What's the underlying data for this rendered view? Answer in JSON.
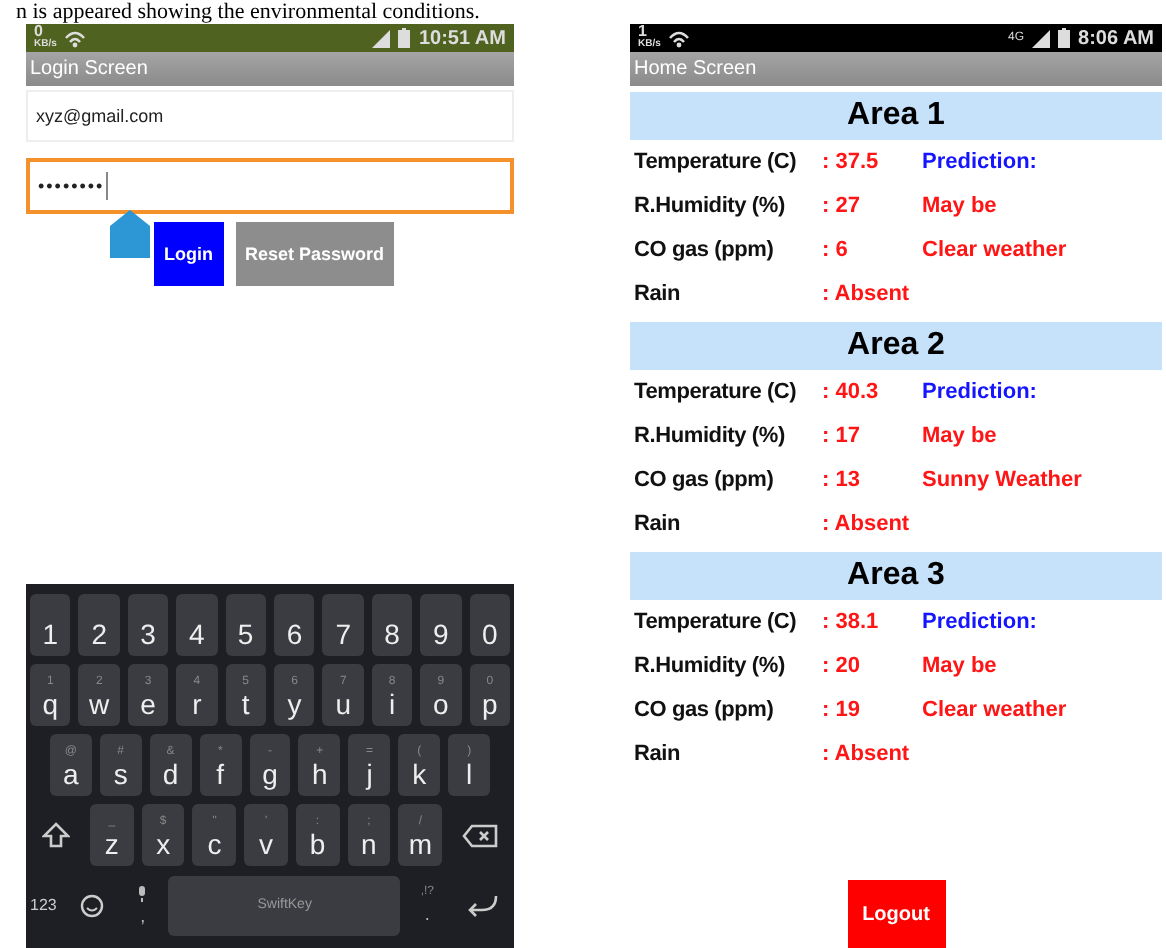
{
  "caption_fragment": "n is appeared showing the environmental conditions.",
  "login_phone": {
    "status_bar": {
      "speed": "0",
      "speed_unit": "KB/s",
      "time": "10:51 AM"
    },
    "title": "Login Screen",
    "email_field": {
      "value": "xyz@gmail.com"
    },
    "password_field": {
      "value": "••••••••",
      "focused": true
    },
    "buttons": [
      {
        "label": "Login",
        "kind": "primary"
      },
      {
        "label": "Reset Password",
        "kind": "secondary"
      }
    ],
    "keyboard": {
      "rows": [
        [
          {
            "label": "1"
          },
          {
            "label": "2"
          },
          {
            "label": "3"
          },
          {
            "label": "4"
          },
          {
            "label": "5"
          },
          {
            "label": "6"
          },
          {
            "label": "7"
          },
          {
            "label": "8"
          },
          {
            "label": "9"
          },
          {
            "label": "0"
          }
        ],
        [
          {
            "label": "q",
            "hint": "1"
          },
          {
            "label": "w",
            "hint": "2"
          },
          {
            "label": "e",
            "hint": "3"
          },
          {
            "label": "r",
            "hint": "4"
          },
          {
            "label": "t",
            "hint": "5"
          },
          {
            "label": "y",
            "hint": "6"
          },
          {
            "label": "u",
            "hint": "7"
          },
          {
            "label": "i",
            "hint": "8"
          },
          {
            "label": "o",
            "hint": "9"
          },
          {
            "label": "p",
            "hint": "0"
          }
        ],
        [
          {
            "label": "a",
            "hint": "@"
          },
          {
            "label": "s",
            "hint": "#"
          },
          {
            "label": "d",
            "hint": "&"
          },
          {
            "label": "f",
            "hint": "*"
          },
          {
            "label": "g",
            "hint": "-"
          },
          {
            "label": "h",
            "hint": "+"
          },
          {
            "label": "j",
            "hint": "="
          },
          {
            "label": "k",
            "hint": "("
          },
          {
            "label": "l",
            "hint": ")"
          }
        ],
        [
          {
            "label": "z",
            "hint": "_"
          },
          {
            "label": "x",
            "hint": "$"
          },
          {
            "label": "c",
            "hint": "\""
          },
          {
            "label": "v",
            "hint": "'"
          },
          {
            "label": "b",
            "hint": ":"
          },
          {
            "label": "n",
            "hint": ";"
          },
          {
            "label": "m",
            "hint": "/"
          }
        ]
      ],
      "numbers_key": "123",
      "space_label": "SwiftKey",
      "comma_key": ",",
      "period_key": ".",
      "period_hint": ",!?"
    }
  },
  "home_phone": {
    "status_bar": {
      "speed": "1",
      "speed_unit": "KB/s",
      "network": "4G",
      "time": "8:06 AM"
    },
    "title": "Home Screen",
    "areas": [
      {
        "title": "Area 1",
        "rows": [
          {
            "label": "Temperature (C)",
            "value": ": 37.5",
            "note": "Prediction:",
            "kind": "heading"
          },
          {
            "label": "R.Humidity (%)",
            "value": ": 27",
            "note": "May be",
            "kind": "result"
          },
          {
            "label": "CO gas (ppm)",
            "value": ": 6",
            "note": "Clear weather",
            "kind": "result"
          },
          {
            "label": "Rain",
            "value": ": Absent"
          }
        ]
      },
      {
        "title": "Area 2",
        "rows": [
          {
            "label": "Temperature (C)",
            "value": ": 40.3",
            "note": "Prediction:",
            "kind": "heading"
          },
          {
            "label": "R.Humidity (%)",
            "value": ": 17",
            "note": "May be",
            "kind": "result"
          },
          {
            "label": "CO gas (ppm)",
            "value": ": 13",
            "note": "Sunny Weather",
            "kind": "result"
          },
          {
            "label": "Rain",
            "value": ": Absent"
          }
        ]
      },
      {
        "title": "Area 3",
        "rows": [
          {
            "label": "Temperature (C)",
            "value": ": 38.1",
            "note": "Prediction:",
            "kind": "heading"
          },
          {
            "label": "R.Humidity (%)",
            "value": ": 20",
            "note": "May be",
            "kind": "result"
          },
          {
            "label": "CO gas (ppm)",
            "value": ": 19",
            "note": "Clear weather",
            "kind": "result"
          },
          {
            "label": "Rain",
            "value": ": Absent"
          }
        ]
      }
    ],
    "logout_button": "Logout"
  }
}
